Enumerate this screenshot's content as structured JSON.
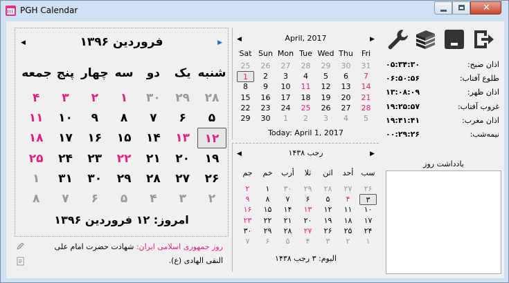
{
  "window": {
    "title": "PGH Calendar",
    "min_label": "",
    "max_label": "",
    "close_label": "✕"
  },
  "persian": {
    "title": "فروردین ۱۳۹۶",
    "weekdays": [
      "شنبه",
      "یک",
      "دو",
      "سه",
      "چهار",
      "پنج",
      "جمعه"
    ],
    "rows": [
      [
        {
          "t": "۲۸",
          "c": "dim"
        },
        {
          "t": "۲۹",
          "c": "dim"
        },
        {
          "t": "۳۰",
          "c": "dim"
        },
        {
          "t": "۱",
          "c": "red"
        },
        {
          "t": "۲",
          "c": "red"
        },
        {
          "t": "۳",
          "c": "red"
        },
        {
          "t": "۴",
          "c": "red"
        }
      ],
      [
        {
          "t": "۵",
          "c": "blk"
        },
        {
          "t": "۶",
          "c": "blk"
        },
        {
          "t": "۷",
          "c": "blk"
        },
        {
          "t": "۸",
          "c": "blk"
        },
        {
          "t": "۹",
          "c": "blk"
        },
        {
          "t": "۱۰",
          "c": "blk"
        },
        {
          "t": "۱۱",
          "c": "red"
        }
      ],
      [
        {
          "t": "۱۲",
          "c": "red sel"
        },
        {
          "t": "۱۳",
          "c": "red"
        },
        {
          "t": "۱۴",
          "c": "blk"
        },
        {
          "t": "۱۵",
          "c": "blk"
        },
        {
          "t": "۱۶",
          "c": "blk"
        },
        {
          "t": "۱۷",
          "c": "blk"
        },
        {
          "t": "۱۸",
          "c": "red"
        }
      ],
      [
        {
          "t": "۱۹",
          "c": "blk"
        },
        {
          "t": "۲۰",
          "c": "blk"
        },
        {
          "t": "۲۱",
          "c": "blk"
        },
        {
          "t": "۲۲",
          "c": "red"
        },
        {
          "t": "۲۳",
          "c": "blk"
        },
        {
          "t": "۲۴",
          "c": "blk"
        },
        {
          "t": "۲۵",
          "c": "red"
        }
      ],
      [
        {
          "t": "۲۶",
          "c": "blk"
        },
        {
          "t": "۲۷",
          "c": "blk"
        },
        {
          "t": "۲۸",
          "c": "blk"
        },
        {
          "t": "۲۹",
          "c": "blk"
        },
        {
          "t": "۳۰",
          "c": "blk"
        },
        {
          "t": "۳۱",
          "c": "blk"
        },
        {
          "t": "۱",
          "c": "dim"
        }
      ],
      [
        {
          "t": "۲",
          "c": "dim"
        },
        {
          "t": "۳",
          "c": "dim"
        },
        {
          "t": "۴",
          "c": "dim"
        },
        {
          "t": "۵",
          "c": "dim"
        },
        {
          "t": "۶",
          "c": "dim"
        },
        {
          "t": "۷",
          "c": "dim"
        },
        {
          "t": "۸",
          "c": "dim"
        }
      ]
    ],
    "today": "امروز: ۱۲ فروردین ۱۳۹۶"
  },
  "note": {
    "event": "روز جمهوری اسلامی ایران:",
    "detail": "شهادت حضرت امام علی النقی الهادی (ع)."
  },
  "gregorian": {
    "title": "April, 2017",
    "weekdays": [
      "Sat",
      "Sun",
      "Mon",
      "Tue",
      "Wed",
      "Thu",
      "Fri"
    ],
    "rows": [
      [
        {
          "t": "25",
          "c": "dim"
        },
        {
          "t": "26",
          "c": "dim"
        },
        {
          "t": "27",
          "c": "dim"
        },
        {
          "t": "28",
          "c": "dim"
        },
        {
          "t": "29",
          "c": "dim"
        },
        {
          "t": "30",
          "c": "dim"
        },
        {
          "t": "31",
          "c": "dim"
        }
      ],
      [
        {
          "t": "1",
          "c": "red sel"
        },
        {
          "t": "2",
          "c": "blk"
        },
        {
          "t": "3",
          "c": "blk"
        },
        {
          "t": "4",
          "c": "blk"
        },
        {
          "t": "5",
          "c": "blk"
        },
        {
          "t": "6",
          "c": "blk"
        },
        {
          "t": "7",
          "c": "red"
        }
      ],
      [
        {
          "t": "8",
          "c": "blk"
        },
        {
          "t": "9",
          "c": "blk"
        },
        {
          "t": "10",
          "c": "blk"
        },
        {
          "t": "11",
          "c": "red"
        },
        {
          "t": "12",
          "c": "blk"
        },
        {
          "t": "13",
          "c": "blk"
        },
        {
          "t": "14",
          "c": "red"
        }
      ],
      [
        {
          "t": "15",
          "c": "blk"
        },
        {
          "t": "16",
          "c": "blk"
        },
        {
          "t": "17",
          "c": "blk"
        },
        {
          "t": "18",
          "c": "blk"
        },
        {
          "t": "19",
          "c": "blk"
        },
        {
          "t": "20",
          "c": "blk"
        },
        {
          "t": "21",
          "c": "red"
        }
      ],
      [
        {
          "t": "22",
          "c": "blk"
        },
        {
          "t": "23",
          "c": "blk"
        },
        {
          "t": "24",
          "c": "blk"
        },
        {
          "t": "25",
          "c": "red"
        },
        {
          "t": "26",
          "c": "blk"
        },
        {
          "t": "27",
          "c": "blk"
        },
        {
          "t": "28",
          "c": "red"
        }
      ],
      [
        {
          "t": "29",
          "c": "blk"
        },
        {
          "t": "30",
          "c": "blk"
        },
        {
          "t": "1",
          "c": "dim"
        },
        {
          "t": "2",
          "c": "dim"
        },
        {
          "t": "3",
          "c": "dim"
        },
        {
          "t": "4",
          "c": "dim"
        },
        {
          "t": "5",
          "c": "dim"
        }
      ]
    ],
    "today": "Today: April 1, 2017"
  },
  "hijri": {
    "title": "رجب ۱۴۳۸",
    "weekdays": [
      "سب",
      "أحد",
      "اثن",
      "ثلا",
      "أرب",
      "خم",
      "جم"
    ],
    "rows": [
      [
        {
          "t": "۲۶",
          "c": "dim"
        },
        {
          "t": "۲۷",
          "c": "dim"
        },
        {
          "t": "۲۸",
          "c": "dim"
        },
        {
          "t": "۲۹",
          "c": "dim"
        },
        {
          "t": "۳۰",
          "c": "dim"
        },
        {
          "t": "۱",
          "c": "blk"
        },
        {
          "t": "۲",
          "c": "red"
        }
      ],
      [
        {
          "t": "۳",
          "c": "blk sel"
        },
        {
          "t": "۴",
          "c": "red"
        },
        {
          "t": "۵",
          "c": "blk"
        },
        {
          "t": "۶",
          "c": "blk"
        },
        {
          "t": "۷",
          "c": "blk"
        },
        {
          "t": "۸",
          "c": "blk"
        },
        {
          "t": "۹",
          "c": "red"
        }
      ],
      [
        {
          "t": "۱۰",
          "c": "blk"
        },
        {
          "t": "۱۱",
          "c": "blk"
        },
        {
          "t": "۱۲",
          "c": "blk"
        },
        {
          "t": "۱۳",
          "c": "red"
        },
        {
          "t": "۱۴",
          "c": "blk"
        },
        {
          "t": "۱۵",
          "c": "blk"
        },
        {
          "t": "۱۶",
          "c": "red"
        }
      ],
      [
        {
          "t": "۱۷",
          "c": "blk"
        },
        {
          "t": "۱۸",
          "c": "blk"
        },
        {
          "t": "۱۹",
          "c": "blk"
        },
        {
          "t": "۲۰",
          "c": "blk"
        },
        {
          "t": "۲۱",
          "c": "blk"
        },
        {
          "t": "۲۲",
          "c": "blk"
        },
        {
          "t": "۲۳",
          "c": "red"
        }
      ],
      [
        {
          "t": "۲۴",
          "c": "blk"
        },
        {
          "t": "۲۵",
          "c": "blk"
        },
        {
          "t": "۲۶",
          "c": "blk"
        },
        {
          "t": "۲۷",
          "c": "red"
        },
        {
          "t": "۲۸",
          "c": "blk"
        },
        {
          "t": "۲۹",
          "c": "blk"
        },
        {
          "t": "۳۰",
          "c": "blk"
        }
      ],
      [
        {
          "t": "۱",
          "c": "dim"
        },
        {
          "t": "۲",
          "c": "dim"
        },
        {
          "t": "۳",
          "c": "dim"
        },
        {
          "t": "۴",
          "c": "dim"
        },
        {
          "t": "۵",
          "c": "dim"
        },
        {
          "t": "۶",
          "c": "dim"
        },
        {
          "t": "۷",
          "c": "dim"
        }
      ]
    ],
    "today": "الیوم: ۳ رجب ۱۴۳۸"
  },
  "tools": {
    "icons": [
      "wrench-icon",
      "books-icon",
      "minimize-tray-icon",
      "exit-icon"
    ]
  },
  "prayer": [
    {
      "name": "اذان صبح:",
      "time": "۰۵:۳۴:۳۰"
    },
    {
      "name": "طلوع آفتاب:",
      "time": "۰۶:۵۰:۵۶"
    },
    {
      "name": "اذان ظهر:",
      "time": "۱۳:۰۸:۰۹"
    },
    {
      "name": "غروب آفتاب:",
      "time": "۱۹:۲۵:۵۷"
    },
    {
      "name": "اذان مغرب:",
      "time": "۱۹:۴۱:۴۱"
    },
    {
      "name": "نیمه‌شب:",
      "time": "۰۰:۲۹:۲۶"
    }
  ],
  "memo": {
    "label": "یادداشت روز",
    "value": ""
  },
  "colors": {
    "holiday": "#e0207e",
    "dim": "#999999",
    "frame": "#cfe0f3"
  }
}
